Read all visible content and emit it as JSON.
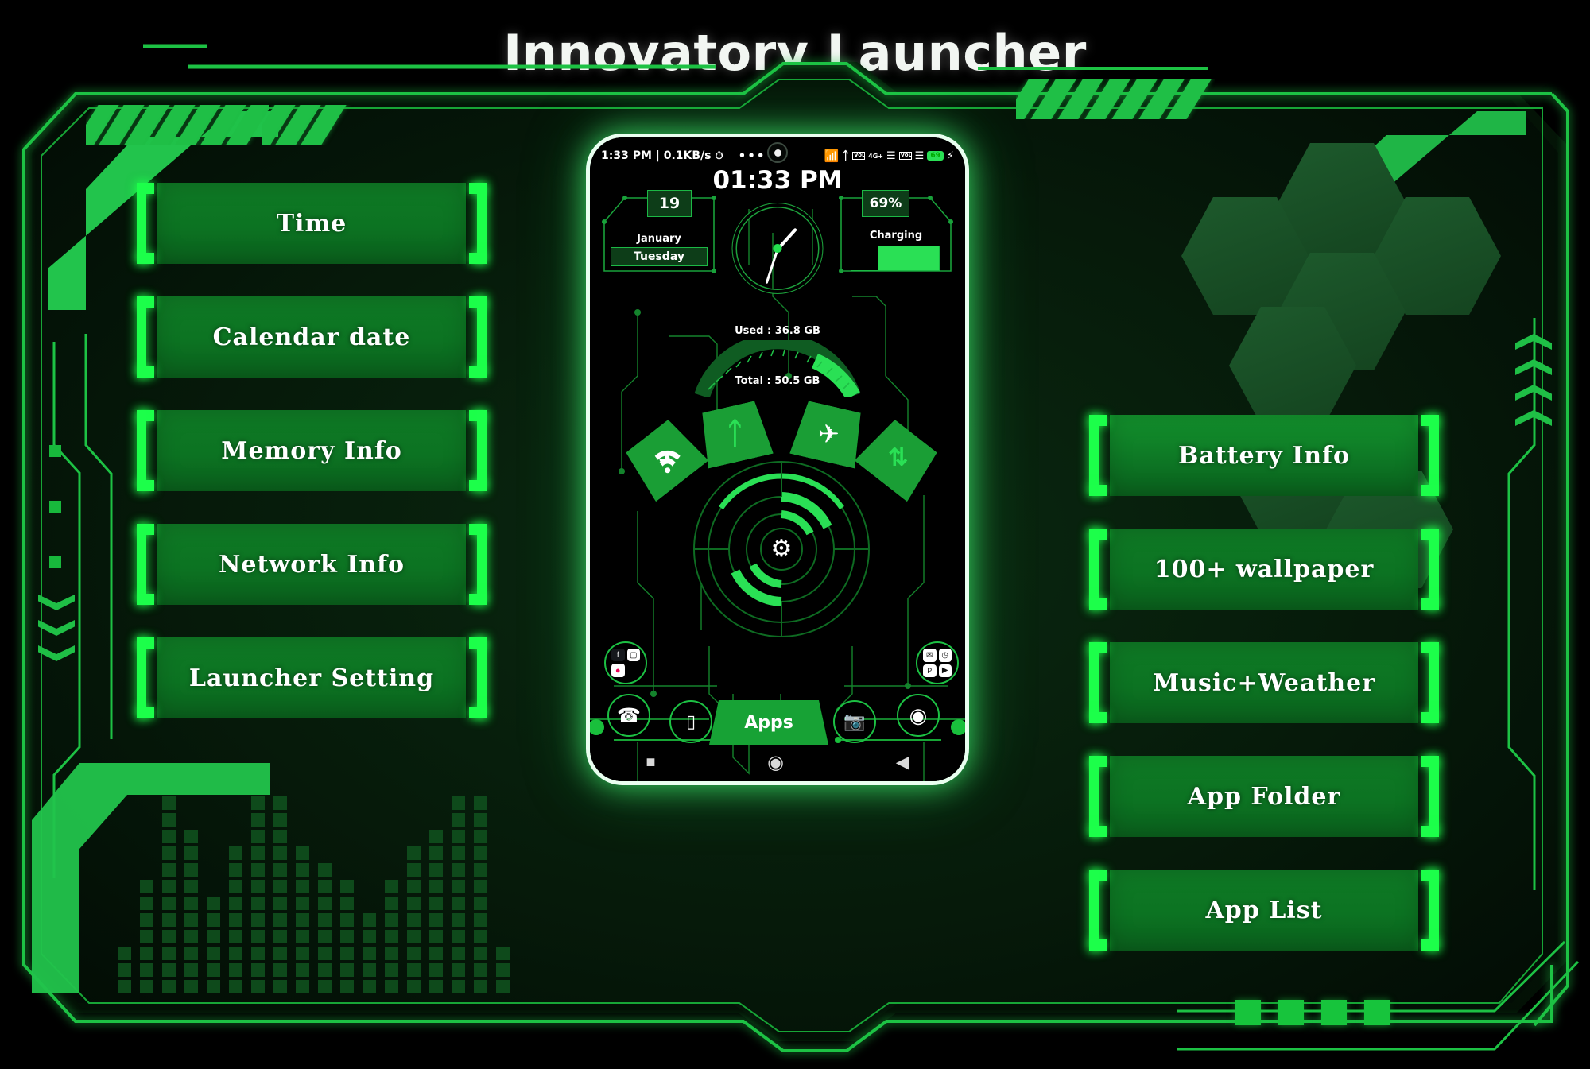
{
  "app": {
    "title": "Innovatory Launcher",
    "accent": "#1cff4a",
    "button_fill": "#0c7322",
    "panel_bg": "#061a09"
  },
  "left_menu": {
    "items": [
      {
        "label": "Time",
        "name": "time"
      },
      {
        "label": "Calendar date",
        "name": "calendar-date"
      },
      {
        "label": "Memory Info",
        "name": "memory-info"
      },
      {
        "label": "Network Info",
        "name": "network-info"
      },
      {
        "label": "Launcher Setting",
        "name": "launcher-setting"
      }
    ]
  },
  "right_menu": {
    "items": [
      {
        "label": "Battery Info",
        "name": "battery-info"
      },
      {
        "label": "100+ wallpaper",
        "name": "wallpaper"
      },
      {
        "label": "Music+Weather",
        "name": "music-weather"
      },
      {
        "label": "App Folder",
        "name": "app-folder"
      },
      {
        "label": "App List",
        "name": "app-list"
      }
    ]
  },
  "phone": {
    "status_bar": {
      "time_and_net": "1:33 PM | 0.1KB/s",
      "alarm_icon": "alarm-icon",
      "dots": "•••",
      "wifi_icon": "wifi-icon",
      "bluetooth_icon": "bluetooth-icon",
      "volte_badge_1": "VoLTE",
      "network_type": "4G+",
      "signal_icon_1": "signal-bars-icon",
      "volte_badge_2": "VoLTE",
      "signal_icon_2": "signal-bars-icon",
      "battery_level": "69",
      "charging_icon": "charging-bolt-icon"
    },
    "clock_label": "01:33 PM",
    "date_widget": {
      "day_number": "19",
      "month": "January",
      "weekday": "Tuesday"
    },
    "battery_widget": {
      "percent": "69%",
      "status": "Charging",
      "fill_percent": 69
    },
    "memory_gauge": {
      "used_label": "Used : 36.8 GB",
      "total_label": "Total : 50.5 GB",
      "used_gb": 36.8,
      "total_gb": 50.5
    },
    "toggles": [
      {
        "name": "wifi-toggle",
        "icon": "wifi-icon",
        "active": true
      },
      {
        "name": "bluetooth-toggle",
        "icon": "bluetooth-icon",
        "active": false
      },
      {
        "name": "airplane-toggle",
        "icon": "airplane-icon",
        "active": true
      },
      {
        "name": "mobile-data-toggle",
        "icon": "data-transfer-icon",
        "active": false
      }
    ],
    "center_button": {
      "name": "settings-gear",
      "icon": "gear-icon"
    },
    "dock": {
      "phone_icon": "phone-icon",
      "messages_icon": "messages-icon",
      "apps_label": "Apps",
      "camera_icon": "camera-icon",
      "browser_icon": "chrome-icon"
    },
    "folders": {
      "left": [
        "facebook-icon",
        "instagram-icon",
        "photos-icon"
      ],
      "right": [
        "mail-icon",
        "clock-icon",
        "paypal-icon",
        "play-icon"
      ]
    },
    "nav": {
      "recents_icon": "recents-square-icon",
      "home_icon": "home-circle-icon",
      "back_icon": "back-triangle-icon"
    }
  },
  "decor": {
    "hexagon_count": 6,
    "bottom_right_squares": 4,
    "left_edge_squares": 3,
    "equalizer_bars": [
      3,
      7,
      12,
      10,
      6,
      9,
      12,
      12,
      9,
      8,
      7,
      5,
      7,
      9,
      10,
      12,
      12,
      3
    ]
  }
}
